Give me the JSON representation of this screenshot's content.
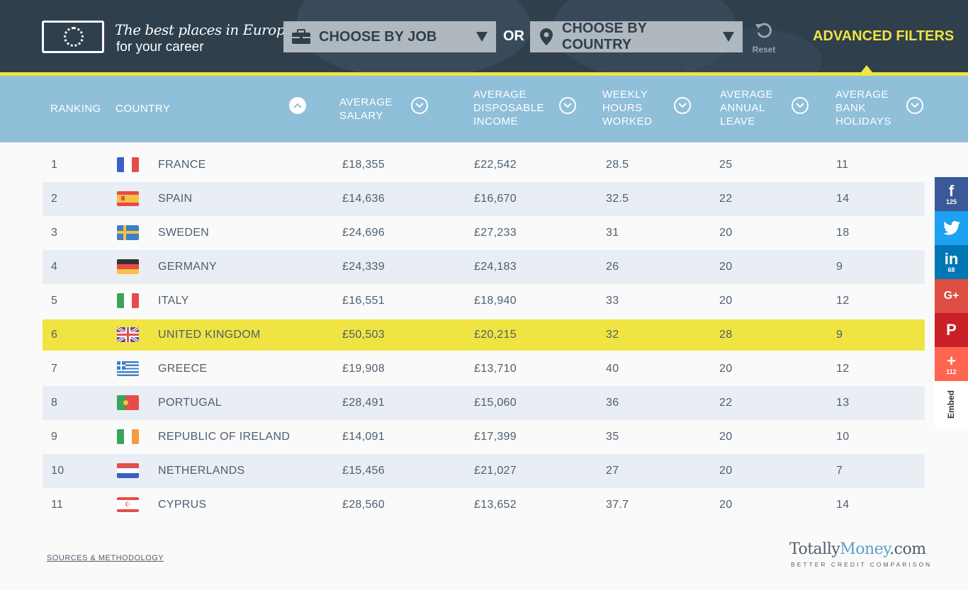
{
  "header": {
    "logo_line1": "The best places in Europe",
    "logo_line2": "for your career",
    "job_dropdown": "CHOOSE BY JOB",
    "or_label": "OR",
    "country_dropdown": "CHOOSE BY COUNTRY",
    "reset_label": "Reset",
    "advanced_filters": "ADVANCED FILTERS"
  },
  "columns": {
    "ranking": "RANKING",
    "country": "COUNTRY",
    "salary": [
      "AVERAGE",
      "SALARY"
    ],
    "disposable": [
      "AVERAGE",
      "DISPOSABLE",
      "INCOME"
    ],
    "hours": [
      "WEEKLY",
      "HOURS",
      "WORKED"
    ],
    "leave": [
      "AVERAGE",
      "ANNUAL",
      "LEAVE"
    ],
    "holidays": [
      "AVERAGE",
      "BANK",
      "HOLIDAYS"
    ]
  },
  "rows": [
    {
      "rank": "1",
      "country": "FRANCE",
      "salary": "£18,355",
      "disposable": "£22,542",
      "hours": "28.5",
      "leave": "25",
      "holidays": "11"
    },
    {
      "rank": "2",
      "country": "SPAIN",
      "salary": "£14,636",
      "disposable": "£16,670",
      "hours": "32.5",
      "leave": "22",
      "holidays": "14"
    },
    {
      "rank": "3",
      "country": "SWEDEN",
      "salary": "£24,696",
      "disposable": "£27,233",
      "hours": "31",
      "leave": "20",
      "holidays": "18"
    },
    {
      "rank": "4",
      "country": "GERMANY",
      "salary": "£24,339",
      "disposable": "£24,183",
      "hours": "26",
      "leave": "20",
      "holidays": "9"
    },
    {
      "rank": "5",
      "country": "ITALY",
      "salary": "£16,551",
      "disposable": "£18,940",
      "hours": "33",
      "leave": "20",
      "holidays": "12"
    },
    {
      "rank": "6",
      "country": "UNITED KINGDOM",
      "salary": "£50,503",
      "disposable": "£20,215",
      "hours": "32",
      "leave": "28",
      "holidays": "9"
    },
    {
      "rank": "7",
      "country": "GREECE",
      "salary": "£19,908",
      "disposable": "£13,710",
      "hours": "40",
      "leave": "20",
      "holidays": "12"
    },
    {
      "rank": "8",
      "country": "PORTUGAL",
      "salary": "£28,491",
      "disposable": "£15,060",
      "hours": "36",
      "leave": "22",
      "holidays": "13"
    },
    {
      "rank": "9",
      "country": "REPUBLIC OF IRELAND",
      "salary": "£14,091",
      "disposable": "£17,399",
      "hours": "35",
      "leave": "20",
      "holidays": "10"
    },
    {
      "rank": "10",
      "country": "NETHERLANDS",
      "salary": "£15,456",
      "disposable": "£21,027",
      "hours": "27",
      "leave": "20",
      "holidays": "7"
    },
    {
      "rank": "11",
      "country": "CYPRUS",
      "salary": "£28,560",
      "disposable": "£13,652",
      "hours": "37.7",
      "leave": "20",
      "holidays": "14"
    }
  ],
  "social": {
    "facebook_count": "125",
    "linkedin_count": "68",
    "more_count": "112",
    "embed_label": "Embed"
  },
  "footer": {
    "sources": "SOURCES & METHODOLOGY",
    "brand_a": "Totally",
    "brand_b": "Money",
    "brand_c": ".com",
    "brand_tagline": "BETTER CREDIT COMPARISON"
  },
  "colors": {
    "header_bg": "#2f3f4c",
    "accent_yellow": "#f0e442",
    "column_header_bg": "#8fbfd9",
    "highlight_row": "#f0e442"
  }
}
